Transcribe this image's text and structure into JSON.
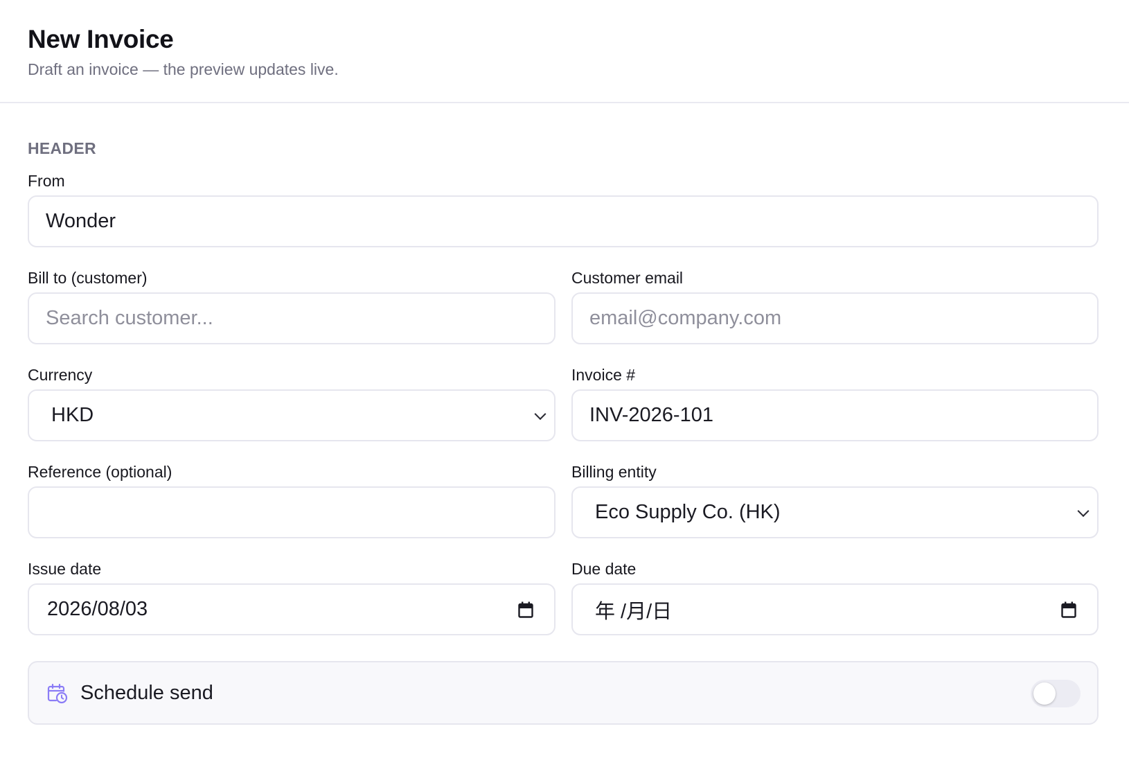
{
  "header": {
    "title": "New Invoice",
    "subtitle": "Draft an invoice — the preview updates live."
  },
  "section": {
    "label": "HEADER"
  },
  "fields": {
    "from": {
      "label": "From",
      "value": "Wonder"
    },
    "bill_to": {
      "label": "Bill to (customer)",
      "value": "",
      "placeholder": "Search customer..."
    },
    "customer_email": {
      "label": "Customer email",
      "value": "",
      "placeholder": "email@company.com"
    },
    "currency": {
      "label": "Currency",
      "value": "HKD"
    },
    "invoice_number": {
      "label": "Invoice #",
      "value": "INV-2026-101"
    },
    "reference": {
      "label": "Reference (optional)",
      "value": ""
    },
    "billing_entity": {
      "label": "Billing entity",
      "value": "Eco Supply Co. (HK)"
    },
    "issue_date": {
      "label": "Issue date",
      "value": "2026/08/03"
    },
    "due_date": {
      "label": "Due date",
      "value": "年 /月/日"
    }
  },
  "schedule_send": {
    "label": "Schedule send",
    "enabled": false,
    "icon": "calendar-clock-icon"
  },
  "colors": {
    "accent_icon": "#8b7cf6",
    "border": "#e6e6ee",
    "muted_text": "#6f6f7f"
  }
}
